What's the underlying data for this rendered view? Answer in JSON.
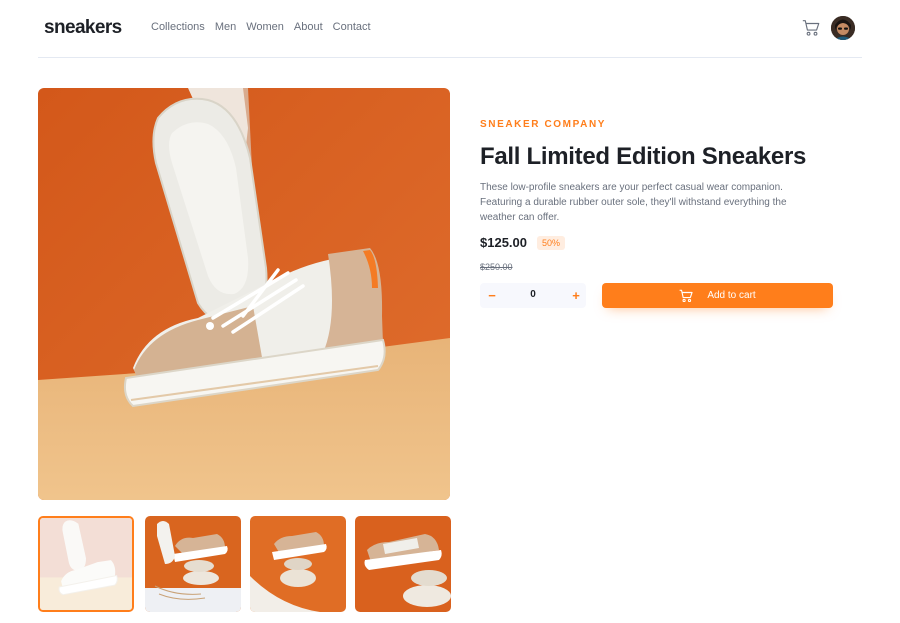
{
  "brand": {
    "logo": "sneakers"
  },
  "nav": {
    "items": [
      "Collections",
      "Men",
      "Women",
      "About",
      "Contact"
    ]
  },
  "header": {
    "cart_icon": "cart-icon",
    "avatar_icon": "avatar"
  },
  "product": {
    "company": "SNEAKER COMPANY",
    "title": "Fall Limited Edition Sneakers",
    "description": "These low-profile sneakers are your perfect casual wear companion. Featuring a durable rubber outer sole, they'll withstand everything the weather can offer.",
    "price": "$125.00",
    "discount": "50%",
    "original_price": "$250.00"
  },
  "cart_controls": {
    "minus_label": "−",
    "quantity": "0",
    "plus_label": "+",
    "add_label": "Add to cart"
  },
  "gallery": {
    "thumbnails": [
      "thumbnail-1",
      "thumbnail-2",
      "thumbnail-3",
      "thumbnail-4"
    ],
    "active_index": 0
  },
  "colors": {
    "accent": "#ff7e1b",
    "accent_pale": "#ffede0",
    "text_dark": "#1d2026",
    "text_gray": "#69707d",
    "stepper_bg": "#f7f8fd"
  }
}
